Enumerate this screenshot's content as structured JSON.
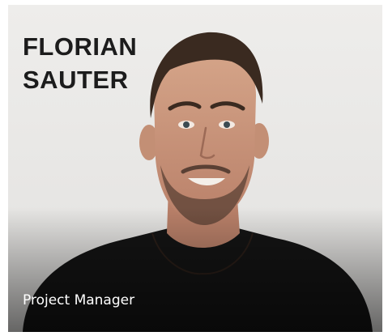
{
  "profile": {
    "name_line_1": "FLORIAN",
    "name_line_2": "SAUTER",
    "role": "Project Manager"
  },
  "colors": {
    "background": "#e9e8e6",
    "name_text": "#1c1c1c",
    "role_text": "#ffffff",
    "shirt": "#141414"
  }
}
